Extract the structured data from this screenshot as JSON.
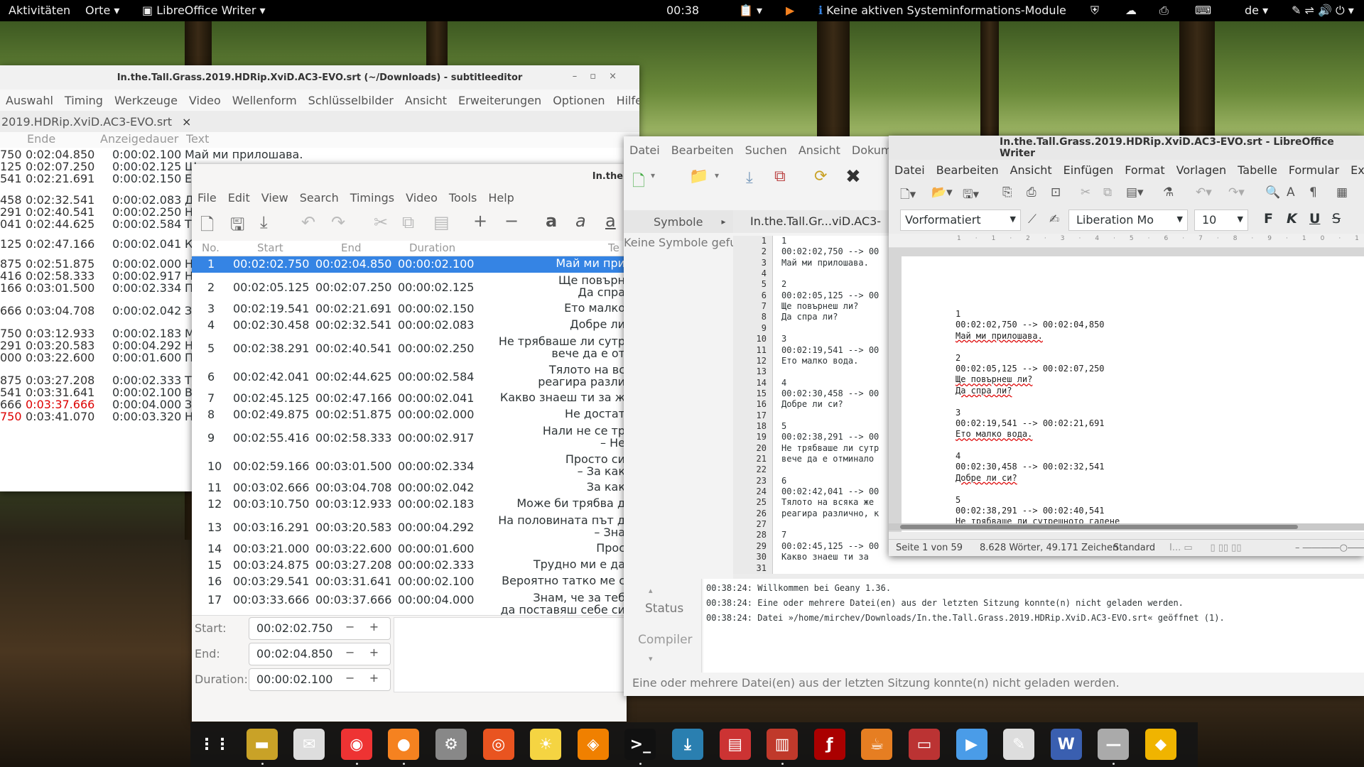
{
  "topbar": {
    "activities": "Aktivitäten",
    "places": "Orte",
    "app": "LibreOffice Writer",
    "clock": "00:38",
    "sysinfo": "Keine aktiven Systeminformations-Module",
    "lang": "de"
  },
  "se": {
    "title": "In.the.Tall.Grass.2019.HDRip.XviD.AC3-EVO.srt (~/Downloads) - subtitleeditor",
    "menu": [
      "Auswahl",
      "Timing",
      "Werkzeuge",
      "Video",
      "Wellenform",
      "Schlüsselbilder",
      "Ansicht",
      "Erweiterungen",
      "Optionen",
      "Hilfe"
    ],
    "tab": "2019.HDRip.XviD.AC3-EVO.srt",
    "headers": [
      "Ende",
      "Anzeigedauer",
      "Text"
    ],
    "rows": [
      [
        "750",
        "0:02:04.850",
        "0:00:02.100",
        "Май ми прилошава."
      ],
      [
        "125",
        "0:02:07.250",
        "0:00:02.125",
        "Щ"
      ],
      [
        "541",
        "0:02:21.691",
        "0:00:02.150",
        "Е"
      ],
      [
        "458",
        "0:02:32.541",
        "0:00:02.083",
        "Д"
      ],
      [
        "291",
        "0:02:40.541",
        "0:00:02.250",
        "Н"
      ],
      [
        "041",
        "0:02:44.625",
        "0:00:02.584",
        "Т"
      ],
      [
        "125",
        "0:02:47.166",
        "0:00:02.041",
        "К"
      ],
      [
        "875",
        "0:02:51.875",
        "0:00:02.000",
        "Н"
      ],
      [
        "416",
        "0:02:58.333",
        "0:00:02.917",
        "Н"
      ],
      [
        "166",
        "0:03:01.500",
        "0:00:02.334",
        "П"
      ],
      [
        "666",
        "0:03:04.708",
        "0:00:02.042",
        "З"
      ],
      [
        "750",
        "0:03:12.933",
        "0:00:02.183",
        "М"
      ],
      [
        "291",
        "0:03:20.583",
        "0:00:04.292",
        "Н"
      ],
      [
        "000",
        "0:03:22.600",
        "0:00:01.600",
        "П"
      ],
      [
        "875",
        "0:03:27.208",
        "0:00:02.333",
        "Т"
      ],
      [
        "541",
        "0:03:31.641",
        "0:00:02.100",
        "В"
      ],
      [
        "666",
        "0:03:37.666",
        "0:00:04.000",
        "З"
      ],
      [
        "750",
        "0:03:41.070",
        "0:00:03.320",
        "Н"
      ]
    ]
  },
  "gs": {
    "title": "In.the.",
    "menu": [
      "File",
      "Edit",
      "View",
      "Search",
      "Timings",
      "Video",
      "Tools",
      "Help"
    ],
    "headers": [
      "No.",
      "Start",
      "End",
      "Duration",
      "Te"
    ],
    "rows": [
      [
        "1",
        "00:02:02.750",
        "00:02:04.850",
        "00:00:02.100",
        "Май ми при"
      ],
      [
        "2",
        "00:02:05.125",
        "00:02:07.250",
        "00:00:02.125",
        "Ще повърн|Да спра"
      ],
      [
        "3",
        "00:02:19.541",
        "00:02:21.691",
        "00:00:02.150",
        "Ето малко"
      ],
      [
        "4",
        "00:02:30.458",
        "00:02:32.541",
        "00:00:02.083",
        "Добре ли"
      ],
      [
        "5",
        "00:02:38.291",
        "00:02:40.541",
        "00:00:02.250",
        "Не трябваше ли сутр|вече да е от"
      ],
      [
        "6",
        "00:02:42.041",
        "00:02:44.625",
        "00:00:02.584",
        "Тялото на вс|реагира разли"
      ],
      [
        "7",
        "00:02:45.125",
        "00:02:47.166",
        "00:00:02.041",
        "Какво знаеш ти за ж"
      ],
      [
        "8",
        "00:02:49.875",
        "00:02:51.875",
        "00:00:02.000",
        "Не достат"
      ],
      [
        "9",
        "00:02:55.416",
        "00:02:58.333",
        "00:00:02.917",
        "Нали не се тр|– Не"
      ],
      [
        "10",
        "00:02:59.166",
        "00:03:01.500",
        "00:00:02.334",
        "Просто си|– За как"
      ],
      [
        "11",
        "00:03:02.666",
        "00:03:04.708",
        "00:00:02.042",
        "За как"
      ],
      [
        "12",
        "00:03:10.750",
        "00:03:12.933",
        "00:00:02.183",
        "Може би трябва д"
      ],
      [
        "13",
        "00:03:16.291",
        "00:03:20.583",
        "00:00:04.292",
        "На половината път д|– Зна"
      ],
      [
        "14",
        "00:03:21.000",
        "00:03:22.600",
        "00:00:01.600",
        "Прос"
      ],
      [
        "15",
        "00:03:24.875",
        "00:03:27.208",
        "00:00:02.333",
        "Трудно ми е да"
      ],
      [
        "16",
        "00:03:29.541",
        "00:03:31.641",
        "00:00:02.100",
        "Вероятно татко ме с"
      ],
      [
        "17",
        "00:03:33.666",
        "00:03:37.666",
        "00:00:04.000",
        "Знам, че за теб|да поставяш себе си"
      ]
    ],
    "start_label": "Start:",
    "start_val": "00:02:02.750",
    "end_label": "End:",
    "end_val": "00:02:04.850",
    "dur_label": "Duration:",
    "dur_val": "00:00:02.100"
  },
  "geany": {
    "menu": [
      "Datei",
      "Bearbeiten",
      "Suchen",
      "Ansicht",
      "Dokume"
    ],
    "sidebar_tab": "Symbole",
    "no_symbols": "Keine Symbole gefun",
    "doc_tab": "In.the.Tall.Gr...viD.AC3-",
    "lines": [
      "1",
      "00:02:02,750 --> 00",
      "Май ми прилошава.",
      "",
      "2",
      "00:02:05,125 --> 00",
      "Ще повърнеш ли?",
      "Да спра ли?",
      "",
      "3",
      "00:02:19,541 --> 00",
      "Ето малко вода.",
      "",
      "4",
      "00:02:30,458 --> 00",
      "Добре ли си?",
      "",
      "5",
      "00:02:38,291 --> 00",
      "Не трябваше ли сутр",
      "вече да е отминало",
      "",
      "6",
      "00:02:42,041 --> 00",
      "Тялото на всяка же",
      "реагира различно, к",
      "",
      "7",
      "00:02:45,125 --> 00",
      "Какво знаеш ти за",
      "",
      ""
    ],
    "status_tab": "Status",
    "compiler_tab": "Compiler",
    "log": [
      "00:38:24: Willkommen bei Geany 1.36.",
      "00:38:24: Eine oder mehrere Datei(en) aus der letzten Sitzung konnte(n) nicht geladen werden.",
      "00:38:24: Datei »/home/mirchev/Downloads/In.the.Tall.Grass.2019.HDRip.XviD.AC3-EVO.srt« geöffnet (1)."
    ],
    "statusbar": "Eine oder mehrere Datei(en) aus der letzten Sitzung konnte(n) nicht geladen werden."
  },
  "lo": {
    "title": "In.the.Tall.Grass.2019.HDRip.XviD.AC3-EVO.srt - LibreOffice Writer",
    "menu": [
      "Datei",
      "Bearbeiten",
      "Ansicht",
      "Einfügen",
      "Format",
      "Vorlagen",
      "Tabelle",
      "Formular",
      "Ext"
    ],
    "style": "Vorformatiert",
    "font": "Liberation Mo",
    "size": "10",
    "doc": [
      "1",
      "00:02:02,750 --> 00:02:04,850",
      "Май ми прилошава.",
      "",
      "2",
      "00:02:05,125 --> 00:02:07,250",
      "Ще повърнеш ли?",
      "Да спра ли?",
      "",
      "3",
      "00:02:19,541 --> 00:02:21,691",
      "Ето малко вода.",
      "",
      "4",
      "00:02:30,458 --> 00:02:32,541",
      "Добре ли си?",
      "",
      "5",
      "00:02:38,291 --> 00:02:40,541",
      "Не трябваше ли сутрешното гадене"
    ],
    "status": [
      "Seite 1 von 59",
      "8.628 Wörter, 49.171 Zeichen",
      "Standard"
    ]
  },
  "dock": [
    "apps-grid-icon",
    "files-icon",
    "mail-icon",
    "chrome-icon",
    "firefox-icon",
    "settings-icon",
    "ubuntu-icon",
    "weather-icon",
    "vlc-icon",
    "terminal-icon",
    "install-icon",
    "document-viewer-icon",
    "book-icon",
    "flash-icon",
    "java-icon",
    "recorder-icon",
    "play-icon",
    "notes-icon",
    "writer-icon",
    "blank-app-icon",
    "ime-icon"
  ]
}
